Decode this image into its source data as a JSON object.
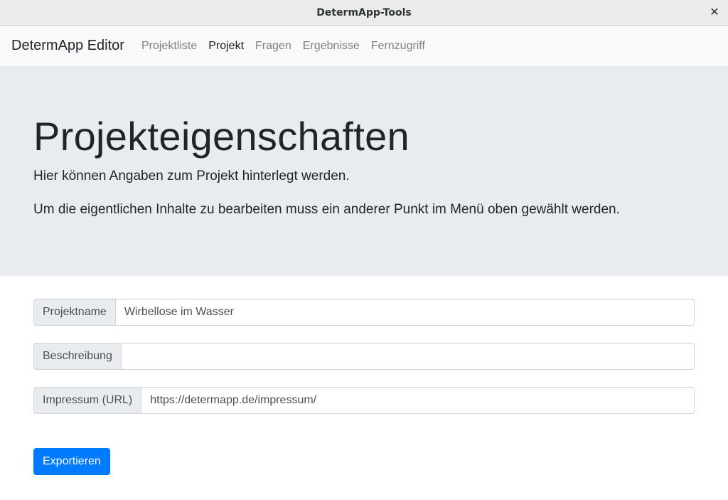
{
  "window": {
    "title": "DetermApp-Tools",
    "close_glyph": "✕"
  },
  "navbar": {
    "brand": "DetermApp Editor",
    "links": [
      {
        "label": "Projektliste",
        "active": false
      },
      {
        "label": "Projekt",
        "active": true
      },
      {
        "label": "Fragen",
        "active": false
      },
      {
        "label": "Ergebnisse",
        "active": false
      },
      {
        "label": "Fernzugriff",
        "active": false
      }
    ]
  },
  "jumbotron": {
    "heading": "Projekteigenschaften",
    "lead1": "Hier können Angaben zum Projekt hinterlegt werden.",
    "lead2": "Um die eigentlichen Inhalte zu bearbeiten muss ein anderer Punkt im Menü oben gewählt werden."
  },
  "form": {
    "fields": [
      {
        "label": "Projektname",
        "value": "Wirbellose im Wasser"
      },
      {
        "label": "Beschreibung",
        "value": ""
      },
      {
        "label": "Impressum (URL)",
        "value": "https://determapp.de/impressum/"
      }
    ],
    "export_label": "Exportieren"
  },
  "colors": {
    "primary": "#007bff",
    "jumbotron_bg": "#e9ecef",
    "navbar_bg": "#f8f9fa"
  }
}
